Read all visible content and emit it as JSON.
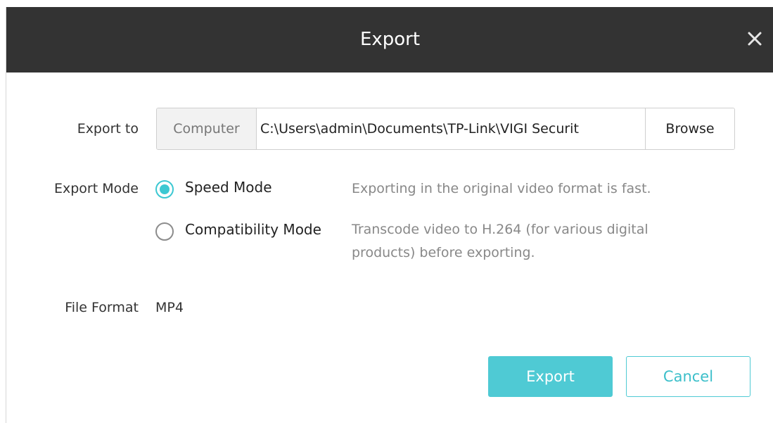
{
  "dialog": {
    "title": "Export",
    "close_icon": "close-icon"
  },
  "export_to": {
    "label": "Export to",
    "source": "Computer",
    "path": "C:\\Users\\admin\\Documents\\TP-Link\\VIGI Securit",
    "browse_label": "Browse"
  },
  "export_mode": {
    "label": "Export Mode",
    "options": [
      {
        "label": "Speed Mode",
        "selected": true,
        "description": "Exporting in the original video format is fast."
      },
      {
        "label": "Compatibility Mode",
        "selected": false,
        "description_line1": "Transcode video to H.264 (for various digital",
        "description_line2": "products) before exporting."
      }
    ]
  },
  "file_format": {
    "label": "File Format",
    "value": "MP4"
  },
  "actions": {
    "export_label": "Export",
    "cancel_label": "Cancel"
  },
  "colors": {
    "titlebar": "#333333",
    "accent": "#4fcad4"
  }
}
